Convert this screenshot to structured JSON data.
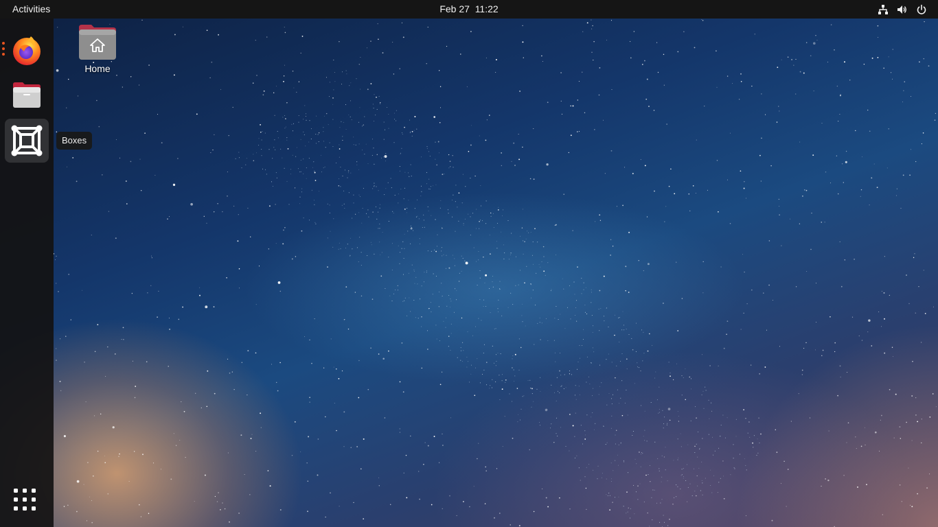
{
  "topbar": {
    "activities_label": "Activities",
    "date": "Feb 27",
    "time": "11:22",
    "tray_icons": [
      "network-icon",
      "volume-icon",
      "power-icon"
    ]
  },
  "dock": {
    "items": [
      {
        "name": "Firefox",
        "icon": "firefox-icon",
        "running": true
      },
      {
        "name": "Files",
        "icon": "files-icon",
        "running": false
      },
      {
        "name": "Boxes",
        "icon": "boxes-icon",
        "running": false,
        "hovered": true
      }
    ],
    "tooltip": "Boxes",
    "show_apps_icon": "app-grid-icon"
  },
  "desktop": {
    "icons": [
      {
        "label": "Home",
        "icon": "home-folder-icon"
      }
    ]
  },
  "colors": {
    "accent": "#e95420",
    "topbar_bg": "#151515",
    "dock_bg": "#141212"
  }
}
